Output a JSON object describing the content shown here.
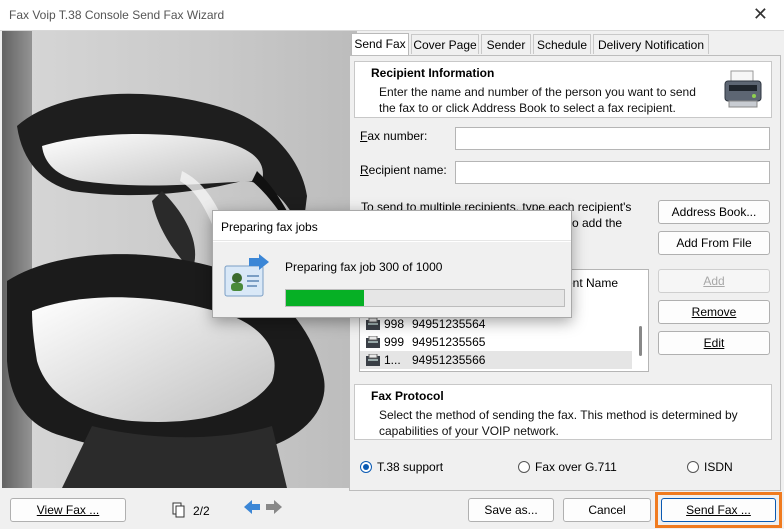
{
  "window": {
    "title": "Fax Voip T.38 Console Send Fax Wizard",
    "close_glyph": "✕"
  },
  "tabs": [
    {
      "label": "Send Fax",
      "active": true
    },
    {
      "label": "Cover Page",
      "active": false
    },
    {
      "label": "Sender",
      "active": false
    },
    {
      "label": "Schedule",
      "active": false
    },
    {
      "label": "Delivery Notification",
      "active": false
    }
  ],
  "recipient_info": {
    "heading": "Recipient Information",
    "desc_line1": "Enter the name and number of the person you want to send",
    "desc_line2": "the fax to or click Address Book to select a fax recipient."
  },
  "fields": {
    "fax_number": {
      "label_key": "F",
      "label_rest": "ax number:",
      "value": ""
    },
    "recipient_name": {
      "label_key": "R",
      "label_rest": "ecipient name:",
      "value": ""
    }
  },
  "multi": {
    "line1": "To send to multiple recipients, type each recipient's",
    "line2": "o add the"
  },
  "buttons": {
    "address_book": "Address Book...",
    "add_from_file": "Add From File",
    "add": "Add",
    "remove": "Remove",
    "edit": "Edit"
  },
  "list": {
    "header_name": "ent Name",
    "rows": [
      {
        "id": "998",
        "number": "94951235564",
        "selected": false
      },
      {
        "id": "999",
        "number": "94951235565",
        "selected": false
      },
      {
        "id": "1...",
        "number": "94951235566",
        "selected": true
      }
    ]
  },
  "fax_protocol": {
    "heading": "Fax Protocol",
    "desc_line1": "Select the method of sending the fax. This method is determined by",
    "desc_line2": "capabilities of your VOIP network.",
    "options": [
      {
        "label": "T.38 support",
        "selected": true
      },
      {
        "label": "Fax over G.711",
        "selected": false
      },
      {
        "label": "ISDN",
        "selected": false
      }
    ]
  },
  "bottom": {
    "view_fax": "View Fax ...",
    "page_indicator": "2/2",
    "save_as": "Save as...",
    "cancel": "Cancel",
    "send_fax": "Send Fax ..."
  },
  "progress_dialog": {
    "title": "Preparing fax jobs",
    "message": "Preparing fax job 300 of 1000",
    "progress_fraction": 0.28
  },
  "colors": {
    "progress_green": "#06b025",
    "send_highlight": "#f07b1f",
    "nav_arrow_blue": "#3b86d6",
    "nav_arrow_gray": "#888888"
  }
}
